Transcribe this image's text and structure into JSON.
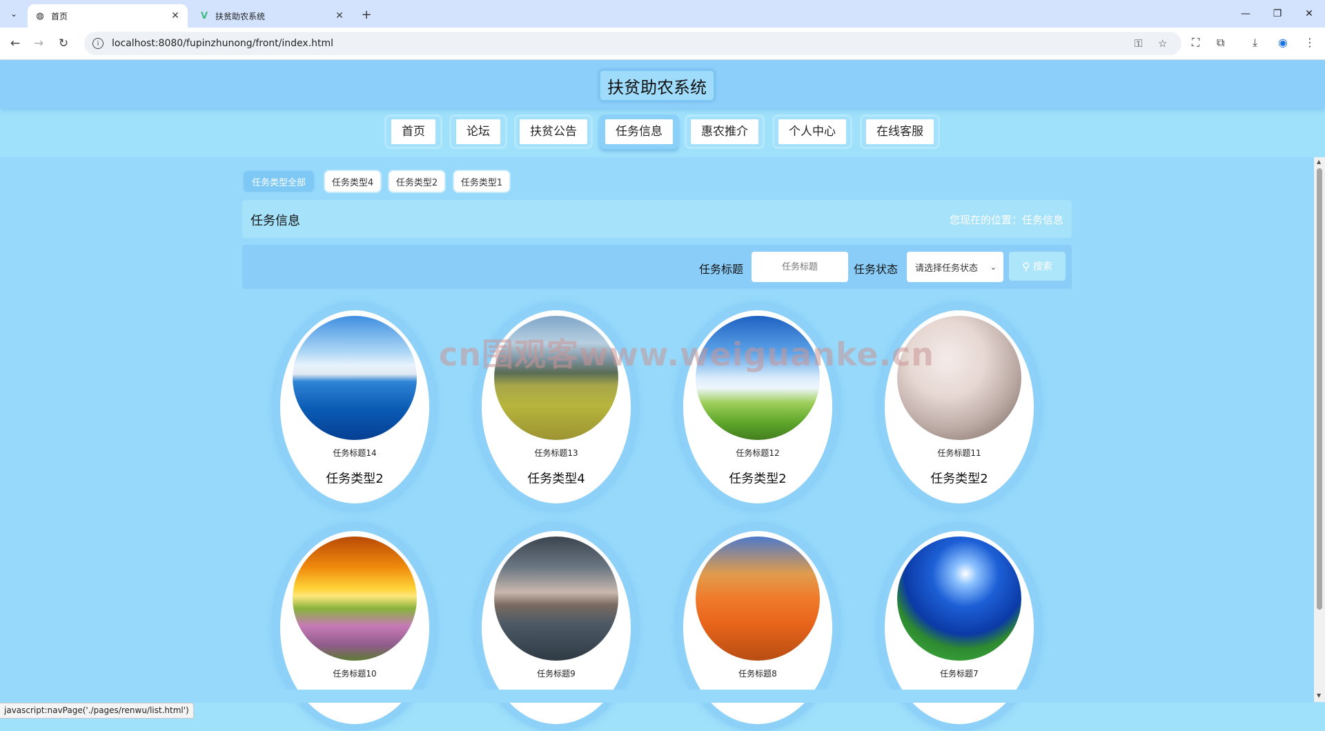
{
  "browser": {
    "tabs": [
      {
        "title": "首页",
        "favicon": "globe-icon",
        "active": true
      },
      {
        "title": "扶贫助农系统",
        "favicon": "vue-logo-icon",
        "active": false
      }
    ],
    "url": "localhost:8080/fupinzhunong/front/index.html",
    "status_tip": "javascript:navPage('./pages/renwu/list.html')"
  },
  "site": {
    "title": "扶贫助农系统"
  },
  "nav": {
    "items": [
      "首页",
      "论坛",
      "扶贫公告",
      "任务信息",
      "惠农推介",
      "个人中心",
      "在线客服"
    ],
    "active_index": 3
  },
  "categories": {
    "items": [
      "任务类型全部",
      "任务类型4",
      "任务类型2",
      "任务类型1"
    ],
    "active_index": 0
  },
  "section": {
    "title": "任务信息",
    "breadcrumb": "您现在的位置：任务信息"
  },
  "search": {
    "title_label": "任务标题",
    "title_placeholder": "任务标题",
    "status_label": "任务状态",
    "status_selected": "请选择任务状态",
    "button_label": "搜索"
  },
  "cards": [
    {
      "title": "任务标题14",
      "type": "任务类型2"
    },
    {
      "title": "任务标题13",
      "type": "任务类型4"
    },
    {
      "title": "任务标题12",
      "type": "任务类型2"
    },
    {
      "title": "任务标题11",
      "type": "任务类型2"
    },
    {
      "title": "任务标题10",
      "type": ""
    },
    {
      "title": "任务标题9",
      "type": ""
    },
    {
      "title": "任务标题8",
      "type": ""
    },
    {
      "title": "任务标题7",
      "type": ""
    }
  ],
  "watermark": "cn围观客www.weiguanke.cn",
  "colors": {
    "header": "#8ccffa",
    "page_bg": "#96d9fb",
    "accent": "#7dc8f5"
  }
}
